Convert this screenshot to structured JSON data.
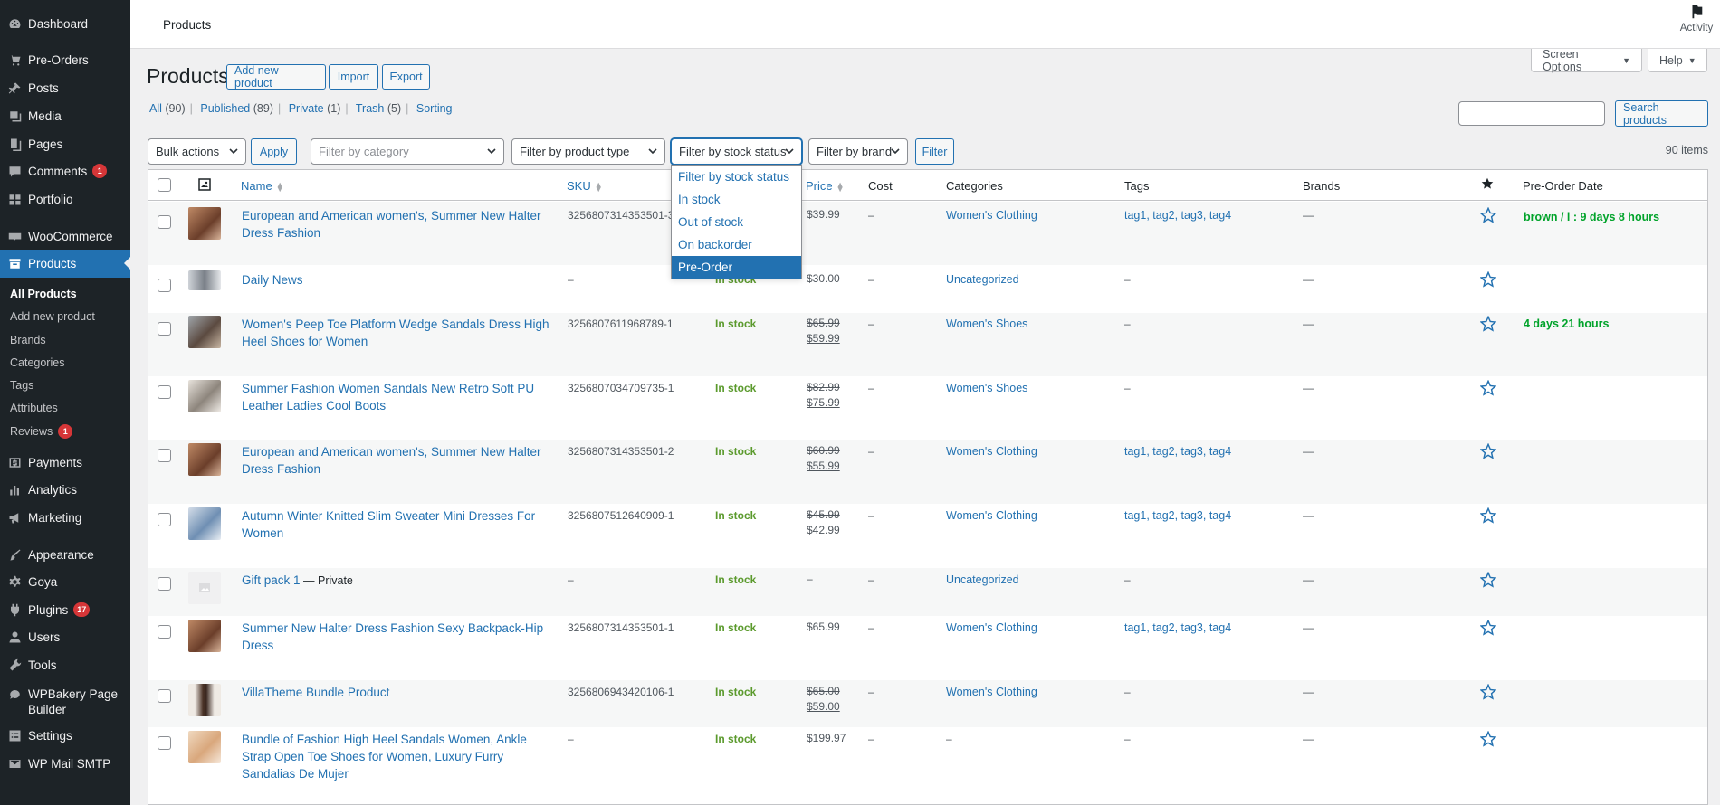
{
  "sidebar": {
    "items": [
      {
        "label": "Dashboard",
        "icon": "dashboard-icon"
      },
      {
        "label": "Pre-Orders",
        "icon": "cart-icon"
      },
      {
        "label": "Posts",
        "icon": "pin-icon"
      },
      {
        "label": "Media",
        "icon": "media-icon"
      },
      {
        "label": "Pages",
        "icon": "pages-icon"
      },
      {
        "label": "Comments",
        "icon": "comment-icon",
        "badge": "1"
      },
      {
        "label": "Portfolio",
        "icon": "portfolio-icon"
      },
      {
        "label": "WooCommerce",
        "icon": "woo-icon"
      },
      {
        "label": "Products",
        "icon": "archive-icon"
      },
      {
        "label": "Payments",
        "icon": "payments-icon"
      },
      {
        "label": "Analytics",
        "icon": "analytics-icon"
      },
      {
        "label": "Marketing",
        "icon": "megaphone-icon"
      },
      {
        "label": "Appearance",
        "icon": "brush-icon"
      },
      {
        "label": "Goya",
        "icon": "gear-icon"
      },
      {
        "label": "Plugins",
        "icon": "plugin-icon",
        "badge": "17"
      },
      {
        "label": "Users",
        "icon": "user-icon"
      },
      {
        "label": "Tools",
        "icon": "wrench-icon"
      },
      {
        "label": "WPBakery Page Builder",
        "icon": "wpbakery-icon"
      },
      {
        "label": "Settings",
        "icon": "settings-icon"
      },
      {
        "label": "WP Mail SMTP",
        "icon": "mail-icon"
      }
    ],
    "submenu": [
      {
        "label": "All Products"
      },
      {
        "label": "Add new product"
      },
      {
        "label": "Brands"
      },
      {
        "label": "Categories"
      },
      {
        "label": "Tags"
      },
      {
        "label": "Attributes"
      },
      {
        "label": "Reviews",
        "badge": "1"
      }
    ]
  },
  "topbar": {
    "breadcrumb": "Products",
    "activity": "Activity"
  },
  "header": {
    "title": "Products",
    "add_new": "Add new product",
    "import": "Import",
    "export": "Export",
    "screen_options": "Screen Options",
    "help": "Help"
  },
  "views": [
    {
      "label": "All",
      "count": "(90)"
    },
    {
      "label": "Published",
      "count": "(89)"
    },
    {
      "label": "Private",
      "count": "(1)"
    },
    {
      "label": "Trash",
      "count": "(5)"
    },
    {
      "label": "Sorting",
      "count": ""
    }
  ],
  "search": {
    "button": "Search products",
    "value": ""
  },
  "filters": {
    "bulk_actions": "Bulk actions",
    "apply": "Apply",
    "category_placeholder": "Filter by category",
    "product_type": "Filter by product type",
    "stock_status": "Filter by stock status",
    "brand": "Filter by brand",
    "filter": "Filter",
    "items_count": "90 items"
  },
  "stock_dropdown": {
    "options": [
      "Filter by stock status",
      "In stock",
      "Out of stock",
      "On backorder",
      "Pre-Order"
    ],
    "highlighted": "Pre-Order"
  },
  "table": {
    "headers": {
      "name": "Name",
      "sku": "SKU",
      "price": "Price",
      "cost": "Cost",
      "categories": "Categories",
      "tags": "Tags",
      "brands": "Brands",
      "preorder": "Pre-Order Date"
    },
    "rows": [
      {
        "name": "European and American women's, Summer New Halter Dress Fashion",
        "sku": "3256807314353501-3",
        "stock": "",
        "price_old": "",
        "price": "$39.99",
        "cost": "–",
        "category": "Women's Clothing",
        "tags": "tag1, tag2, tag3, tag4",
        "brand": "—",
        "preorder": "brown / l : 9 days 8 hours"
      },
      {
        "name": "Daily News",
        "sku": "–",
        "stock": "In stock",
        "price_old": "",
        "price": "$30.00",
        "cost": "–",
        "category": "Uncategorized",
        "tags": "–",
        "brand": "—",
        "preorder": ""
      },
      {
        "name": "Women's Peep Toe Platform Wedge Sandals Dress High Heel Shoes for Women",
        "sku": "3256807611968789-1",
        "stock": "In stock",
        "price_old": "$65.99",
        "price": "$59.99",
        "cost": "–",
        "category": "Women's Shoes",
        "tags": "–",
        "brand": "—",
        "preorder": "4 days 21 hours"
      },
      {
        "name": "Summer Fashion Women Sandals New Retro Soft PU Leather Ladies Cool Boots",
        "sku": "3256807034709735-1",
        "stock": "In stock",
        "price_old": "$82.99",
        "price": "$75.99",
        "cost": "–",
        "category": "Women's Shoes",
        "tags": "–",
        "brand": "—",
        "preorder": ""
      },
      {
        "name": "European and American women's, Summer New Halter Dress Fashion",
        "sku": "3256807314353501-2",
        "stock": "In stock",
        "price_old": "$60.99",
        "price": "$55.99",
        "cost": "–",
        "category": "Women's Clothing",
        "tags": "tag1, tag2, tag3, tag4",
        "brand": "—",
        "preorder": ""
      },
      {
        "name": "Autumn Winter Knitted Slim Sweater Mini Dresses For Women",
        "sku": "3256807512640909-1",
        "stock": "In stock",
        "price_old": "$45.99",
        "price": "$42.99",
        "cost": "–",
        "category": "Women's Clothing",
        "tags": "tag1, tag2, tag3, tag4",
        "brand": "—",
        "preorder": ""
      },
      {
        "name": "Gift pack 1",
        "suffix": " — Private",
        "sku": "–",
        "stock": "In stock",
        "price_old": "",
        "price": "–",
        "cost": "–",
        "category": "Uncategorized",
        "tags": "–",
        "brand": "—",
        "preorder": ""
      },
      {
        "name": "Summer New Halter Dress Fashion Sexy Backpack-Hip Dress",
        "sku": "3256807314353501-1",
        "stock": "In stock",
        "price_old": "",
        "price": "$65.99",
        "cost": "–",
        "category": "Women's Clothing",
        "tags": "tag1, tag2, tag3, tag4",
        "brand": "—",
        "preorder": ""
      },
      {
        "name": "VillaTheme Bundle Product",
        "sku": "3256806943420106-1",
        "stock": "In stock",
        "price_old": "$65.00",
        "price": "$59.00",
        "cost": "–",
        "category": "Women's Clothing",
        "tags": "–",
        "brand": "—",
        "preorder": ""
      },
      {
        "name": "Bundle of Fashion High Heel Sandals Women, Ankle Strap Open Toe Shoes for Women, Luxury Furry Sandalias De Mujer",
        "sku": "–",
        "stock": "In stock",
        "price_old": "",
        "price": "$199.97",
        "cost": "–",
        "category": "–",
        "tags": "–",
        "brand": "—",
        "preorder": ""
      }
    ]
  },
  "colors": {
    "accent": "#2271b1",
    "sidebar": "#1d2327",
    "instock": "#5b9a2d",
    "preorder": "#00a32a",
    "badge": "#d63638"
  }
}
